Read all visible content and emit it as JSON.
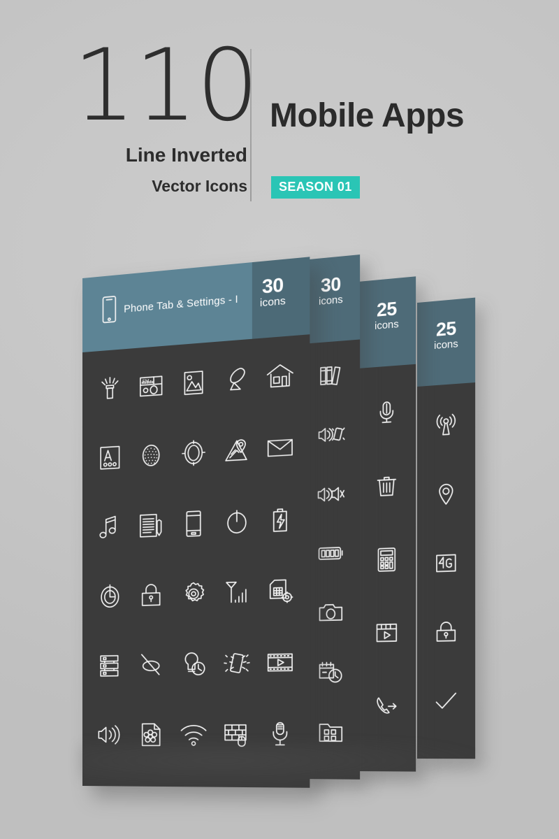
{
  "header": {
    "count": "110",
    "subtitle_line1": "Line Inverted",
    "subtitle_line2": "Vector Icons",
    "title": "Mobile Apps",
    "season_badge": "SEASON 01",
    "accent_color": "#2ac5b5",
    "text_color": "#2d2d2d"
  },
  "palette": {
    "background": "#c6c6c6",
    "card_body": "#3b3b3b",
    "card_header": "#4e6b78",
    "card_header_label": "#5d8495",
    "icon_stroke": "#f2f2f2"
  },
  "cards": [
    {
      "title": "Phone Tab & Settings - I",
      "title_icon": "smartphone-icon",
      "count": "30",
      "count_word": "icons",
      "icons": [
        "flashlight-icon",
        "fm-radio-icon",
        "gallery-image-icon",
        "satellite-dish-icon",
        "home-icon",
        "font-keyboard-icon",
        "fingerprint-icon",
        "compass-lens-icon",
        "map-location-icon",
        "email-envelope-icon",
        "music-note-icon",
        "notepad-pencil-icon",
        "smartphone-icon",
        "power-button-icon",
        "battery-charging-icon",
        "clock-timer-icon",
        "padlock-icon",
        "settings-gear-icon",
        "signal-antenna-icon",
        "sim-card-settings-icon",
        "server-database-icon",
        "sync-off-icon",
        "bulb-timer-icon",
        "vibrate-phone-icon",
        "video-film-icon",
        "speaker-volume-icon",
        "wallpaper-flower-icon",
        "wifi-icon",
        "firewall-mouse-icon",
        "microphone-icon"
      ]
    },
    {
      "title": "",
      "count": "30",
      "count_word": "icons",
      "icons": [
        "books-library-icon",
        "sound-vibrate-icon",
        "sound-mute-icon",
        "battery-full-icon",
        "camera-icon",
        "calendar-clock-icon",
        "app-folder-grid-icon"
      ]
    },
    {
      "title": "",
      "count": "25",
      "count_word": "icons",
      "icons": [
        "microphone-icon",
        "trash-delete-icon",
        "calculator-icon",
        "media-player-icon",
        "outgoing-call-icon"
      ]
    },
    {
      "title": "",
      "count": "25",
      "count_word": "icons",
      "icons": [
        "broadcast-antenna-icon",
        "location-pin-icon",
        "network-4g-icon",
        "padlock-icon",
        "checkmark-icon"
      ]
    }
  ]
}
